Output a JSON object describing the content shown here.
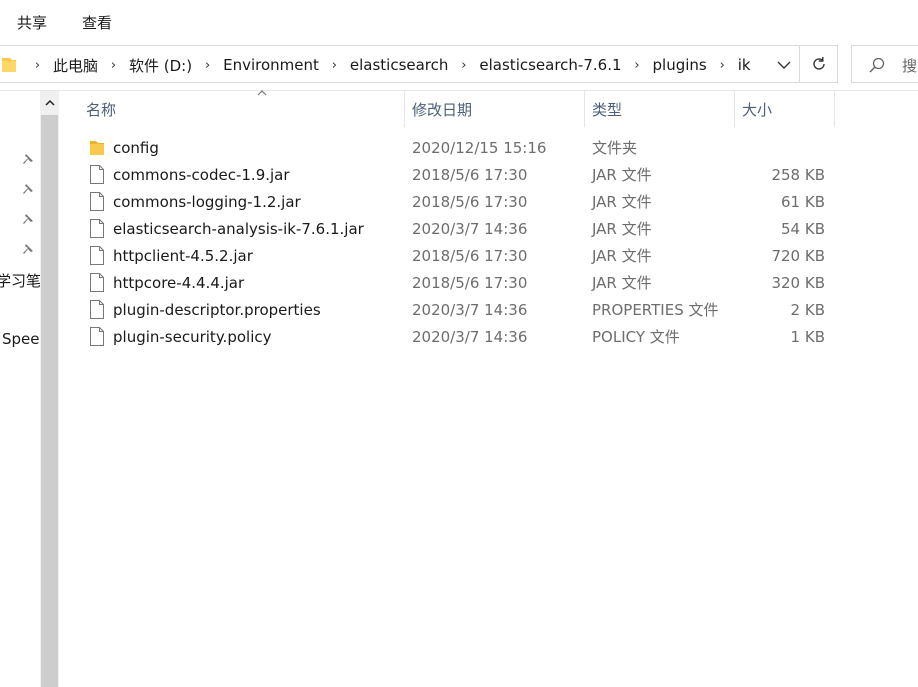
{
  "ribbon": {
    "tabs": [
      "共享",
      "查看"
    ]
  },
  "address_bar": {
    "crumbs": [
      "此电脑",
      "软件 (D:)",
      "Environment",
      "elasticsearch",
      "elasticsearch-7.6.1",
      "plugins",
      "ik"
    ],
    "search_placeholder": "搜"
  },
  "nav_pane": {
    "items": [
      "学习笔",
      "Spee"
    ]
  },
  "columns": {
    "name": "名称",
    "date": "修改日期",
    "type": "类型",
    "size": "大小"
  },
  "files": [
    {
      "name": "config",
      "date": "2020/12/15 15:16",
      "type": "文件夹",
      "size": "",
      "icon": "folder-icon"
    },
    {
      "name": "commons-codec-1.9.jar",
      "date": "2018/5/6 17:30",
      "type": "JAR 文件",
      "size": "258 KB",
      "icon": "file-icon"
    },
    {
      "name": "commons-logging-1.2.jar",
      "date": "2018/5/6 17:30",
      "type": "JAR 文件",
      "size": "61 KB",
      "icon": "file-icon"
    },
    {
      "name": "elasticsearch-analysis-ik-7.6.1.jar",
      "date": "2020/3/7 14:36",
      "type": "JAR 文件",
      "size": "54 KB",
      "icon": "file-icon"
    },
    {
      "name": "httpclient-4.5.2.jar",
      "date": "2018/5/6 17:30",
      "type": "JAR 文件",
      "size": "720 KB",
      "icon": "file-icon"
    },
    {
      "name": "httpcore-4.4.4.jar",
      "date": "2018/5/6 17:30",
      "type": "JAR 文件",
      "size": "320 KB",
      "icon": "file-icon"
    },
    {
      "name": "plugin-descriptor.properties",
      "date": "2020/3/7 14:36",
      "type": "PROPERTIES 文件",
      "size": "2 KB",
      "icon": "file-icon"
    },
    {
      "name": "plugin-security.policy",
      "date": "2020/3/7 14:36",
      "type": "POLICY 文件",
      "size": "1 KB",
      "icon": "file-icon"
    }
  ],
  "colors": {
    "folder": "#f8c94a",
    "header_text": "#4c607a",
    "secondary_text": "#6d6d6d"
  }
}
